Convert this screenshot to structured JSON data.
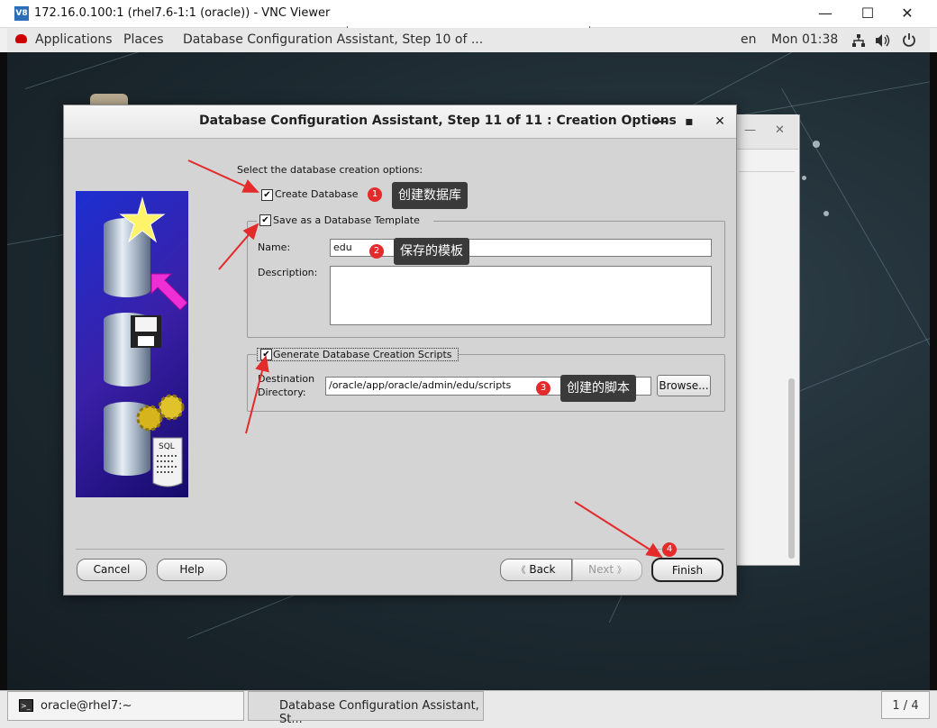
{
  "vnc": {
    "logo": "V8",
    "title": "172.16.0.100:1 (rhel7.6-1:1 (oracle)) - VNC Viewer",
    "minimize": "—",
    "maximize": "☐",
    "close": "✕"
  },
  "gnome": {
    "applications": "Applications",
    "places": "Places",
    "active_window": "Database Configuration Assistant, Step 10 of ...",
    "language": "en",
    "clock": "Mon 01:38",
    "network_icon": "network-icon",
    "volume_icon": "volume-icon",
    "power_icon": "power-icon"
  },
  "background_window": {
    "minimize": "—",
    "maximize": "☐",
    "close": "✕"
  },
  "dialog": {
    "title": "Database Configuration Assistant, Step 11 of 11 : Creation Options",
    "minimize": "—",
    "maximize": "▪",
    "close": "✕",
    "prompt": "Select the database creation options:",
    "create_database": {
      "label": "Create Database",
      "checked": true
    },
    "save_template": {
      "label": "Save as a Database Template",
      "checked": true
    },
    "name_label": "Name:",
    "name_value": "edu",
    "description_label": "Description:",
    "description_value": "",
    "generate_scripts": {
      "label": "Generate Database Creation Scripts",
      "checked": true
    },
    "destination_label_1": "Destination",
    "destination_label_2": "Directory:",
    "destination_value": "/oracle/app/oracle/admin/edu/scripts",
    "browse": "Browse...",
    "cancel": "Cancel",
    "help": "Help",
    "back": "Back",
    "next": "Next",
    "finish": "Finish",
    "check_mark": "✔",
    "back_arrow": "《",
    "next_arrow": "》"
  },
  "annotations": [
    {
      "number": "1",
      "text": "创建数据库"
    },
    {
      "number": "2",
      "text": "保存的模板"
    },
    {
      "number": "3",
      "text": "创建的脚本"
    },
    {
      "number": "4",
      "text": ""
    }
  ],
  "taskbar": {
    "terminal": "oracle@rhel7:~",
    "dbca": "Database Configuration Assistant, St...",
    "pager": "1 / 4",
    "terminal_glyph": ">_"
  },
  "colors": {
    "annotation_red": "#e32b2b",
    "tooltip_bg": "#3a3a3a",
    "dialog_bg": "#d4d4d4",
    "desktop_bg": "#1d2a31"
  }
}
